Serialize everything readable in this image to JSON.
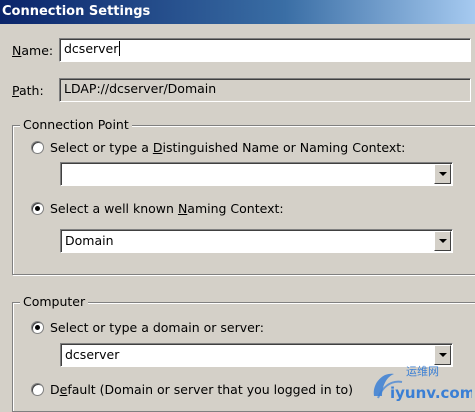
{
  "window": {
    "title": "Connection Settings"
  },
  "name_field": {
    "label_prefix": "",
    "label_mnemonic": "N",
    "label_suffix": "ame:",
    "value": "dcserver"
  },
  "path_field": {
    "label_mnemonic": "P",
    "label_suffix": "ath:",
    "value": "LDAP://dcserver/Domain"
  },
  "connection_point": {
    "legend": "Connection Point",
    "option_dn": {
      "pre": "Select or type a ",
      "mnemonic": "D",
      "post": "istinguished Name or Naming Context:",
      "selected": false
    },
    "dn_combo": {
      "value": ""
    },
    "option_wellknown": {
      "pre": "Select a well known ",
      "mnemonic": "N",
      "post": "aming Context:",
      "selected": true
    },
    "wellknown_combo": {
      "value": "Domain"
    }
  },
  "computer": {
    "legend": "Computer",
    "option_server": {
      "pre": "Select or type a domain or server:",
      "selected": true
    },
    "server_combo": {
      "value": "dcserver"
    },
    "option_default": {
      "pre": "D",
      "mnemonic": "e",
      "post": "fault (Domain or server that you logged in to)",
      "selected": false
    }
  },
  "watermark": {
    "brand": "iyunv.com",
    "chinese": "运维网"
  },
  "colors": {
    "titlebar_start": "#0a246a",
    "titlebar_end": "#a6caf0",
    "dialog_bg": "#d4d0c8",
    "watermark": "#3a7fd5"
  }
}
